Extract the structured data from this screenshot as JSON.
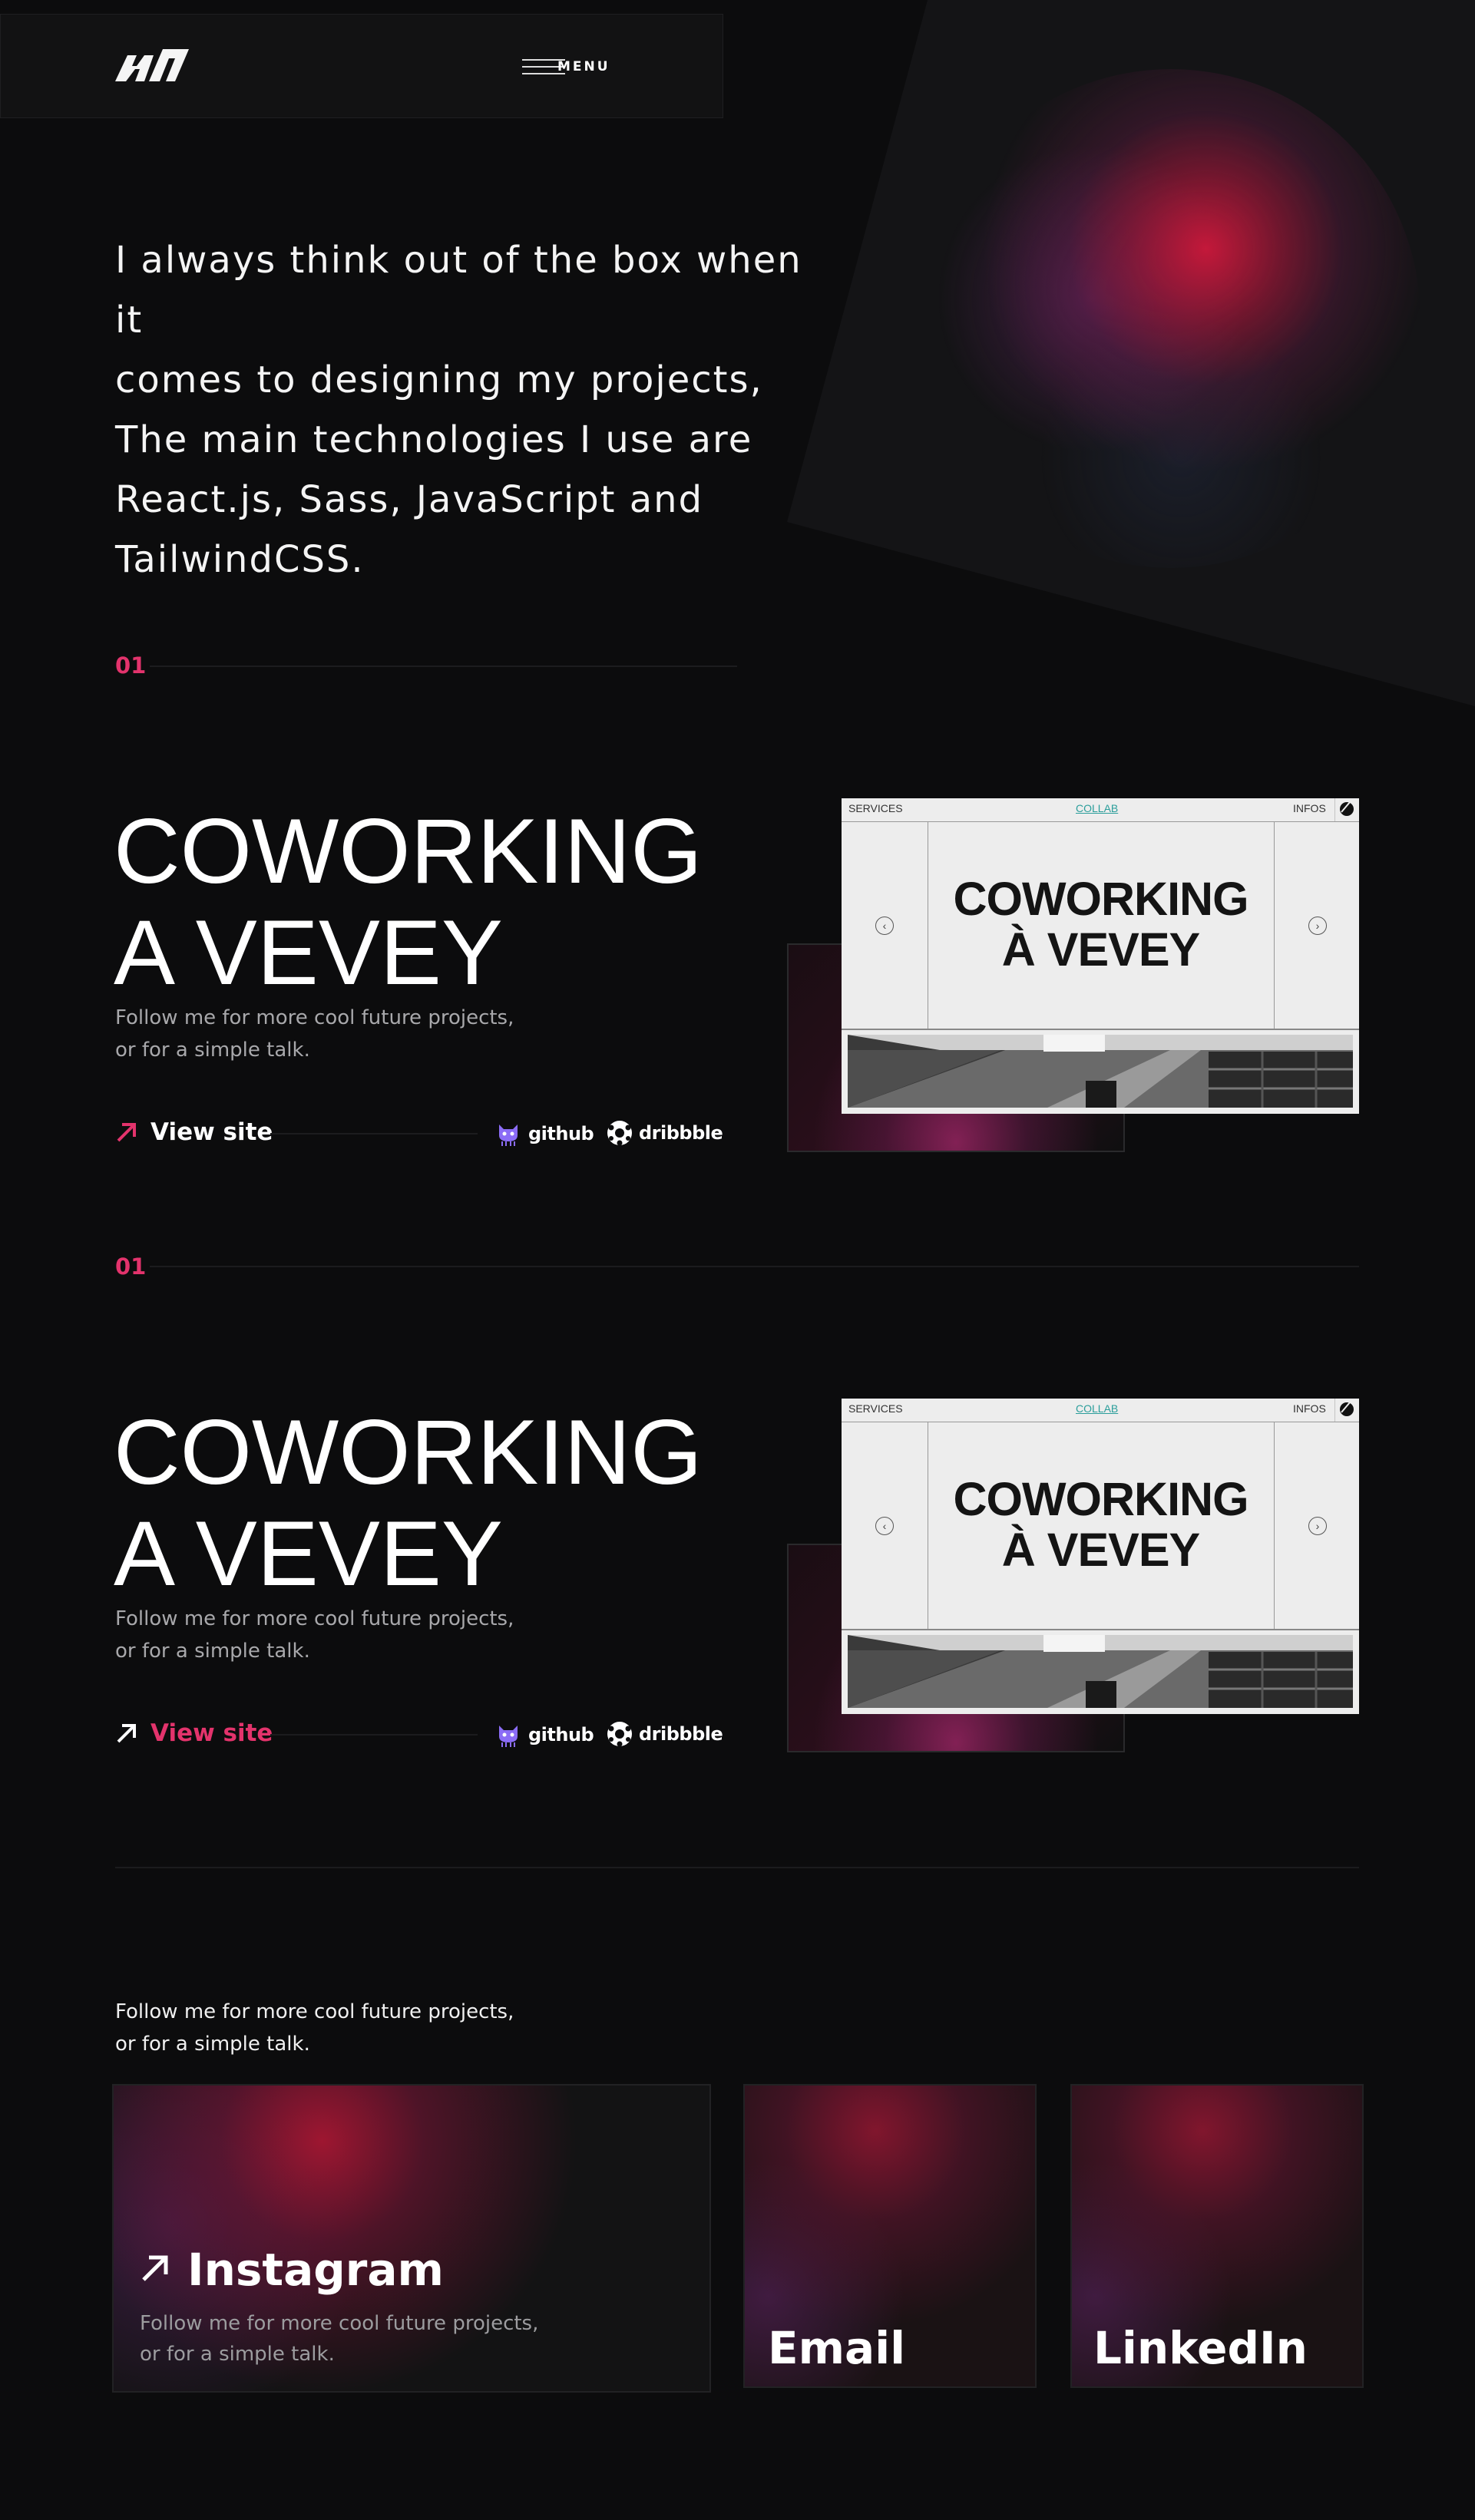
{
  "header": {
    "logo": "logo-mark",
    "menu_label": "MENU"
  },
  "hero": {
    "lines": [
      "I always think out of the box when it",
      "comes to designing my projects,",
      "The main technologies I use are",
      "React.js, Sass, JavaScript and",
      "TailwindCSS."
    ]
  },
  "projects": [
    {
      "number": "01",
      "title_line1": "COWORKING",
      "title_line2": "A VEVEY",
      "subtitle_line1": "Follow me for more cool future projects,",
      "subtitle_line2": "or for a simple talk.",
      "view_site": "View site",
      "github": "github",
      "dribbble": "dribbble",
      "preview": {
        "nav_left": "SERVICES",
        "nav_center": "COLLAB",
        "nav_right": "INFOS",
        "title_line1": "COWORKING",
        "title_line2": "À VEVEY"
      }
    },
    {
      "number": "01",
      "title_line1": "COWORKING",
      "title_line2": "A VEVEY",
      "subtitle_line1": "Follow me for more cool future projects,",
      "subtitle_line2": "or for a simple talk.",
      "view_site": "View site",
      "github": "github",
      "dribbble": "dribbble",
      "preview": {
        "nav_left": "SERVICES",
        "nav_center": "COLLAB",
        "nav_right": "INFOS",
        "title_line1": "COWORKING",
        "title_line2": "À VEVEY"
      }
    }
  ],
  "contact": {
    "intro_line1": "Follow me for more cool future projects,",
    "intro_line2": "or for a simple talk.",
    "instagram": {
      "title": "Instagram",
      "sub_line1": "Follow me for more cool future projects,",
      "sub_line2": "or for a simple talk."
    },
    "email": {
      "title": "Email"
    },
    "linkedin": {
      "title": "LinkedIn"
    }
  },
  "colors": {
    "accent": "#e3336c",
    "background": "#0c0c0d",
    "github_icon": "#8b6cf6"
  }
}
